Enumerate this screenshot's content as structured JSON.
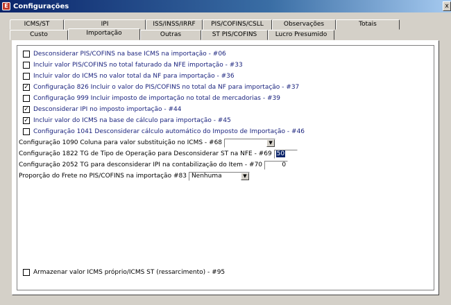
{
  "window": {
    "title": "Configurações",
    "close_label": "x",
    "icon_letter": "E"
  },
  "tabs_row1": [
    {
      "label": "ICMS/ST"
    },
    {
      "label": "IPI"
    },
    {
      "label": "ISS/INSS/IRRF"
    },
    {
      "label": "PIS/COFINS/CSLL"
    },
    {
      "label": "Observações"
    },
    {
      "label": "Totais"
    }
  ],
  "tabs_row2": [
    {
      "label": "Custo"
    },
    {
      "label": "Importação"
    },
    {
      "label": "Outras"
    },
    {
      "label": "ST PIS/COFINS"
    },
    {
      "label": "Lucro Presumido"
    }
  ],
  "options": [
    {
      "label": "Desconsiderar PIS/COFINS na base ICMS na importação - #06",
      "checked": false,
      "style": "blue"
    },
    {
      "label": "Incluir valor PIS/COFINS no total faturado da NFE importação - #33",
      "checked": false,
      "style": "blue"
    },
    {
      "label": "Incluir valor do ICMS no valor total da NF para importação - #36",
      "checked": false,
      "style": "blue"
    },
    {
      "label": "Configuração 826 Incluir o valor do PIS/COFINS no total da NF para importação - #37",
      "checked": true,
      "style": "blue"
    },
    {
      "label": "Configuração 999 Incluir imposto de importação no total de mercadorias - #39",
      "checked": false,
      "style": "blue"
    },
    {
      "label": "Desconsiderar IPI no imposto importação - #44",
      "checked": true,
      "style": "blue"
    },
    {
      "label": "Incluir valor do ICMS na base de cálculo para importação - #45",
      "checked": true,
      "style": "blue"
    },
    {
      "label": "Configuração 1041 Desconsiderar cálculo automático do Imposto de Importação - #46",
      "checked": false,
      "style": "blue"
    }
  ],
  "fields": {
    "coluna_label": "Configuração 1090 Coluna para valor substituição no ICMS - #68",
    "coluna_value": "",
    "tg_st_label": "Configuração 1822 TG de Tipo de Operação para Desconsiderar ST na NFE - #69",
    "tg_st_value": "50",
    "tg_ipi_label": "Configuração 2052 TG para desconsiderar IPI na contabilização do Item - #70",
    "tg_ipi_value": "0",
    "frete_label": "Proporção do Frete no PIS/COFINS na importação  #83",
    "frete_value": "Nenhuma"
  },
  "bottom_option": {
    "label": "Armazenar valor ICMS próprio/ICMS ST (ressarcimento) - #95",
    "checked": false
  }
}
